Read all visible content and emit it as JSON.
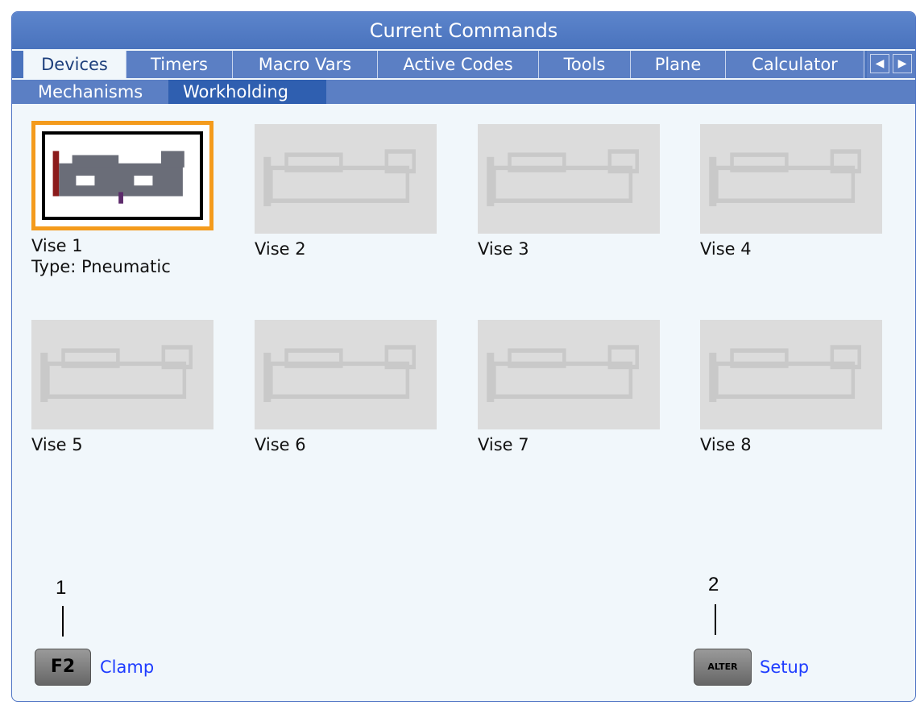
{
  "window": {
    "title": "Current Commands"
  },
  "tabs": [
    {
      "label": "Devices",
      "active": true
    },
    {
      "label": "Timers"
    },
    {
      "label": "Macro Vars"
    },
    {
      "label": "Active Codes"
    },
    {
      "label": "Tools"
    },
    {
      "label": "Plane"
    },
    {
      "label": "Calculator"
    }
  ],
  "tab_arrows": {
    "left": "◀",
    "right": "▶"
  },
  "subtabs": [
    {
      "label": "Mechanisms"
    },
    {
      "label": "Workholding",
      "active": true
    }
  ],
  "vises": [
    {
      "name": "Vise 1",
      "type": "Type: Pneumatic",
      "selected": true
    },
    {
      "name": "Vise 2"
    },
    {
      "name": "Vise 3"
    },
    {
      "name": "Vise 4"
    },
    {
      "name": "Vise 5"
    },
    {
      "name": "Vise 6"
    },
    {
      "name": "Vise 7"
    },
    {
      "name": "Vise 8"
    }
  ],
  "callouts": {
    "one": "1",
    "two": "2"
  },
  "actions": {
    "clamp": {
      "key": "F2",
      "label": "Clamp"
    },
    "setup": {
      "key": "ALTER",
      "label": "Setup"
    }
  },
  "colors": {
    "accent": "#4a73bd",
    "selected_border": "#f49b1c",
    "action_text": "#1e3cff"
  }
}
